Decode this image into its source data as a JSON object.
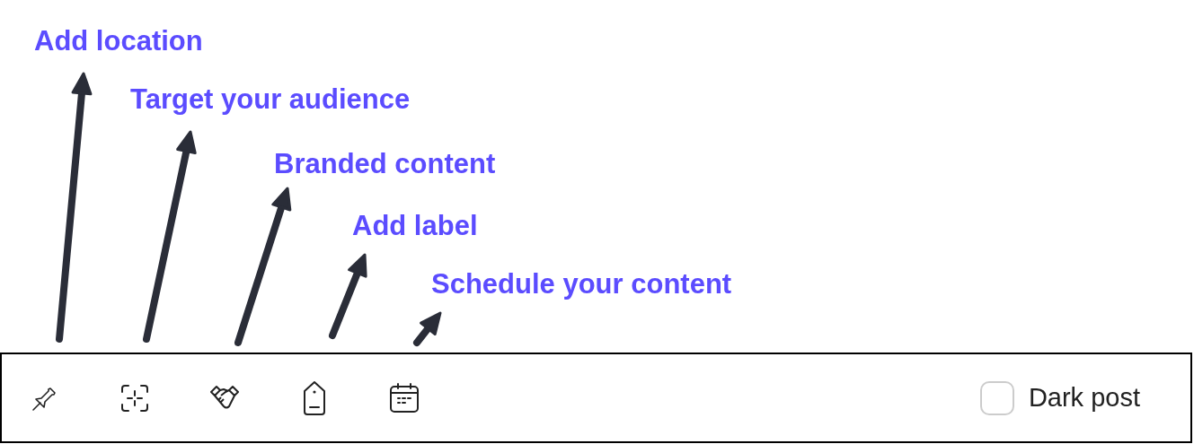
{
  "annotations": [
    {
      "text": "Add location"
    },
    {
      "text": "Target your audience"
    },
    {
      "text": "Branded content"
    },
    {
      "text": "Add label"
    },
    {
      "text": "Schedule your content"
    }
  ],
  "toolbar": {
    "tools": [
      {
        "kind": "pin"
      },
      {
        "kind": "target"
      },
      {
        "kind": "handshake"
      },
      {
        "kind": "tag"
      },
      {
        "kind": "calendar"
      }
    ],
    "dark_post": {
      "label": "Dark post",
      "checked": false
    }
  }
}
